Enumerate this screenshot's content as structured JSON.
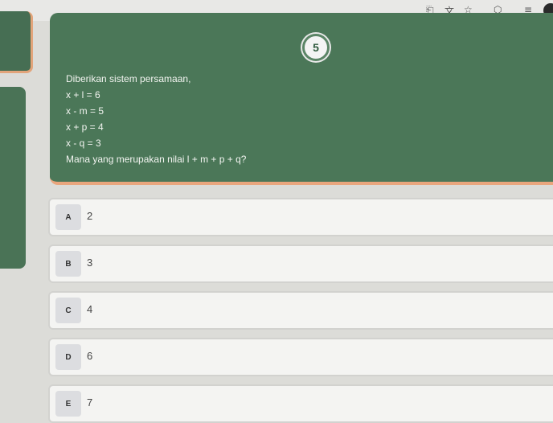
{
  "browser": {
    "icons": [
      "screenshot-icon",
      "translate-icon",
      "bookmark-star-icon",
      "extensions-icon",
      "menu-icon"
    ]
  },
  "question": {
    "number": "5",
    "lines": [
      "Diberikan sistem persamaan,",
      "x + l = 6",
      "x - m = 5",
      "x + p = 4",
      "x - q = 3",
      "Mana yang merupakan nilai l + m + p + q?"
    ]
  },
  "options": [
    {
      "letter": "A",
      "value": "2"
    },
    {
      "letter": "B",
      "value": "3"
    },
    {
      "letter": "C",
      "value": "4"
    },
    {
      "letter": "D",
      "value": "6"
    },
    {
      "letter": "E",
      "value": "7"
    }
  ],
  "colors": {
    "card_green": "#4b7758",
    "accent_orange": "#e9a67d",
    "option_bg": "#f4f4f2"
  }
}
